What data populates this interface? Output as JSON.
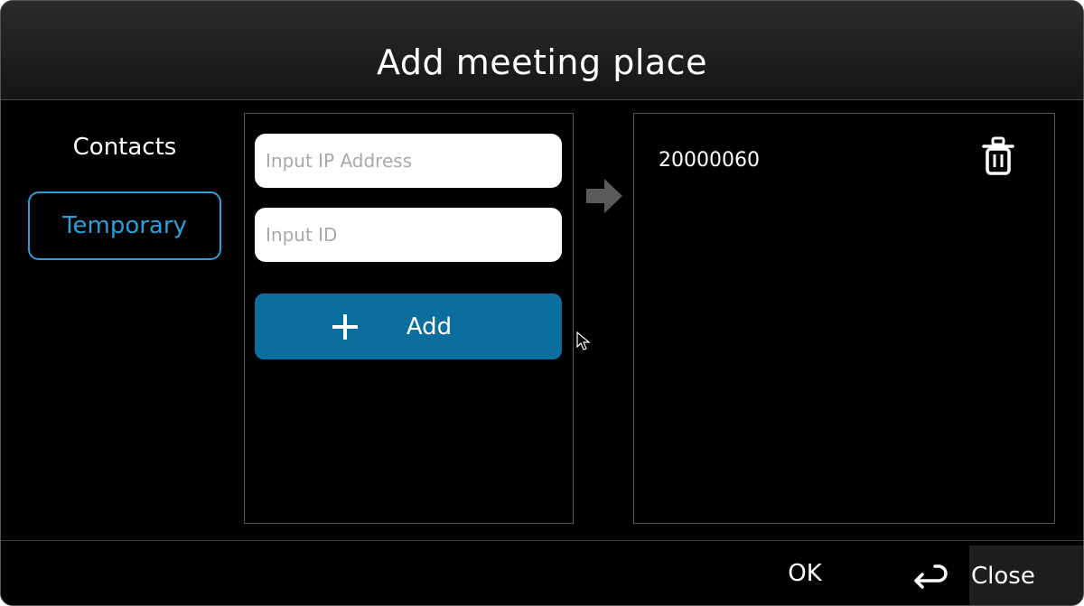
{
  "dialog": {
    "title": "Add meeting place"
  },
  "sidebar": {
    "items": [
      {
        "label": "Contacts",
        "selected": false
      },
      {
        "label": "Temporary",
        "selected": true
      }
    ]
  },
  "form": {
    "ip_input": {
      "placeholder": "Input IP Address",
      "value": ""
    },
    "id_input": {
      "placeholder": "Input ID",
      "value": ""
    },
    "add_button": {
      "label": "Add",
      "icon": "plus-icon"
    },
    "transfer_icon": "arrow-right-icon"
  },
  "selected_list": {
    "items": [
      {
        "id": "20000060",
        "action_icon": "trash-icon"
      }
    ]
  },
  "footer": {
    "ok_label": "OK",
    "close_label": "Close",
    "close_icon": "return-icon"
  },
  "colors": {
    "accent": "#2a9fd8",
    "button": "#0c6e9f",
    "background": "#000000",
    "titlebar": "#222222"
  }
}
